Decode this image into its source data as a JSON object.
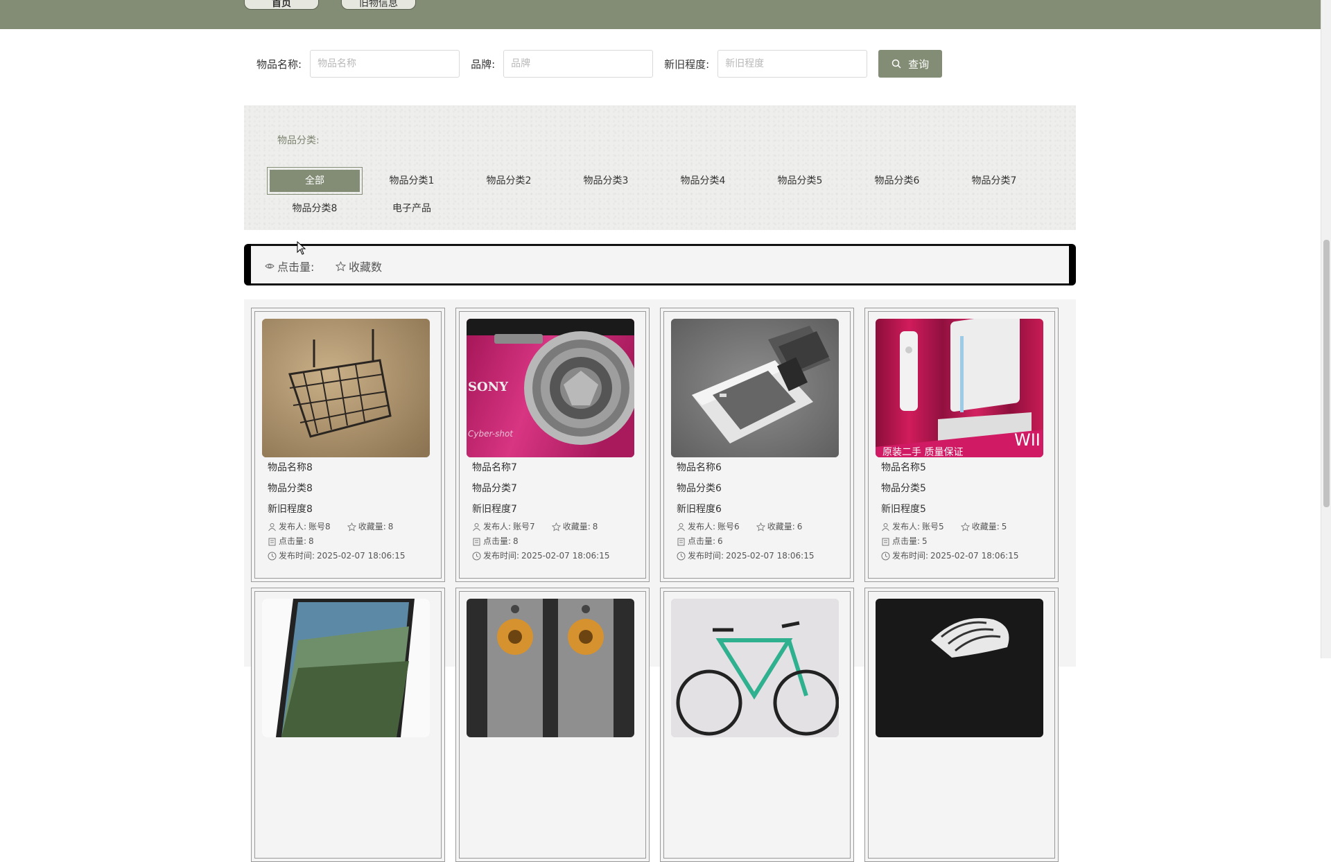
{
  "nav": {
    "tabs": [
      {
        "label": "首页"
      },
      {
        "label": "旧物信息"
      }
    ]
  },
  "search": {
    "name_label": "物品名称:",
    "name_placeholder": "物品名称",
    "brand_label": "品牌:",
    "brand_placeholder": "品牌",
    "condition_label": "新旧程度:",
    "condition_placeholder": "新旧程度",
    "submit_label": "查询",
    "submit_icon": "search-icon"
  },
  "categories": {
    "title": "物品分类:",
    "items": [
      "全部",
      "物品分类1",
      "物品分类2",
      "物品分类3",
      "物品分类4",
      "物品分类5",
      "物品分类6",
      "物品分类7",
      "物品分类8",
      "电子产品"
    ],
    "selected": "全部"
  },
  "sort": {
    "clicks_label": "点击量:",
    "clicks_icon": "eye-icon",
    "favorites_label": "收藏数",
    "favorites_icon": "star-icon"
  },
  "goods": [
    {
      "name": "物品名称8",
      "category": "物品分类8",
      "condition": "新旧程度8",
      "publisher_label": "发布人:",
      "publisher": "账号8",
      "fav_label": "收藏量:",
      "fav": "8",
      "clicks_label": "点击量:",
      "clicks": "8",
      "time_label": "发布时间:",
      "time": "2025-02-07 18:06:15",
      "image": "wire-basket"
    },
    {
      "name": "物品名称7",
      "category": "物品分类7",
      "condition": "新旧程度7",
      "publisher_label": "发布人:",
      "publisher": "账号7",
      "fav_label": "收藏量:",
      "fav": "8",
      "clicks_label": "点击量:",
      "clicks": "8",
      "time_label": "发布时间:",
      "time": "2025-02-07 18:06:15",
      "image": "pink-camera",
      "image_text": [
        "SONY",
        "Cyber-shot"
      ]
    },
    {
      "name": "物品名称6",
      "category": "物品分类6",
      "condition": "新旧程度6",
      "publisher_label": "发布人:",
      "publisher": "账号6",
      "fav_label": "收藏量:",
      "fav": "6",
      "clicks_label": "点击量:",
      "clicks": "6",
      "time_label": "发布时间:",
      "time": "2025-02-07 18:06:15",
      "image": "flip-phone"
    },
    {
      "name": "物品名称5",
      "category": "物品分类5",
      "condition": "新旧程度5",
      "publisher_label": "发布人:",
      "publisher": "账号5",
      "fav_label": "收藏量:",
      "fav": "5",
      "clicks_label": "点击量:",
      "clicks": "5",
      "time_label": "发布时间:",
      "time": "2025-02-07 18:06:15",
      "image": "game-console",
      "image_text": [
        "原装二手 质量保证",
        "WII"
      ]
    }
  ],
  "goods_row2_images": [
    "laptop",
    "speakers",
    "bicycle",
    "sneaker"
  ],
  "colors": {
    "accent": "#838c74",
    "panel": "#eeeeec",
    "card_bg": "#f4f4f4"
  }
}
